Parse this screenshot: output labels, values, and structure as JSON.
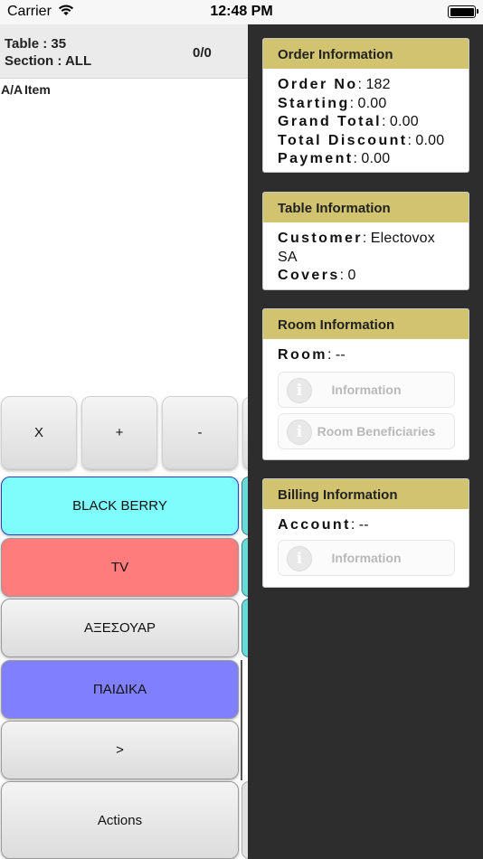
{
  "status_bar": {
    "carrier": "Carrier",
    "wifi_icon": "wifi-icon",
    "time": "12:48 PM",
    "battery_icon": "battery-icon"
  },
  "order": {
    "table": "Table : 35",
    "section": "Section : ALL",
    "count": "0/0",
    "columns": [
      "A/A",
      "Item"
    ]
  },
  "keypad": {
    "clear": "X",
    "plus": "+",
    "minus": "-"
  },
  "categories": [
    {
      "label": "BLACK BERRY",
      "color": "#7ffcfc"
    },
    {
      "label": "TV",
      "color": "#fe7c7c"
    },
    {
      "label": "ΑΞΕΣΟΥΑΡ",
      "color": "#e8e8e8"
    },
    {
      "label": "ΠΑΙΔΙΚΑ",
      "color": "#8080fe"
    },
    {
      "label": ">",
      "color": "#e8e8e8"
    }
  ],
  "actions_label": "Actions",
  "order_info": {
    "title": "Order Information",
    "order_no_label": "Order No",
    "order_no": "182",
    "starting_label": "Starting",
    "starting": "0.00",
    "grand_total_label": "Grand Total",
    "grand_total": "0.00",
    "total_discount_label": "Total Discount",
    "total_discount": "0.00",
    "payment_label": "Payment",
    "payment": "0.00"
  },
  "table_info": {
    "title": "Table Information",
    "customer_label": "Customer",
    "customer_line1": "Electovox",
    "customer_line2": "SA",
    "covers_label": "Covers",
    "covers": "0"
  },
  "room_info": {
    "title": "Room Information",
    "room_label": "Room",
    "room": "--",
    "info_button": "Information",
    "beneficiaries_button": "Room Beneficiaries"
  },
  "billing_info": {
    "title": "Billing Information",
    "account_label": "Account",
    "account": "--",
    "info_button": "Information"
  },
  "colors": {
    "card_header": "#d1c370",
    "right_background": "#2d2d2d"
  }
}
